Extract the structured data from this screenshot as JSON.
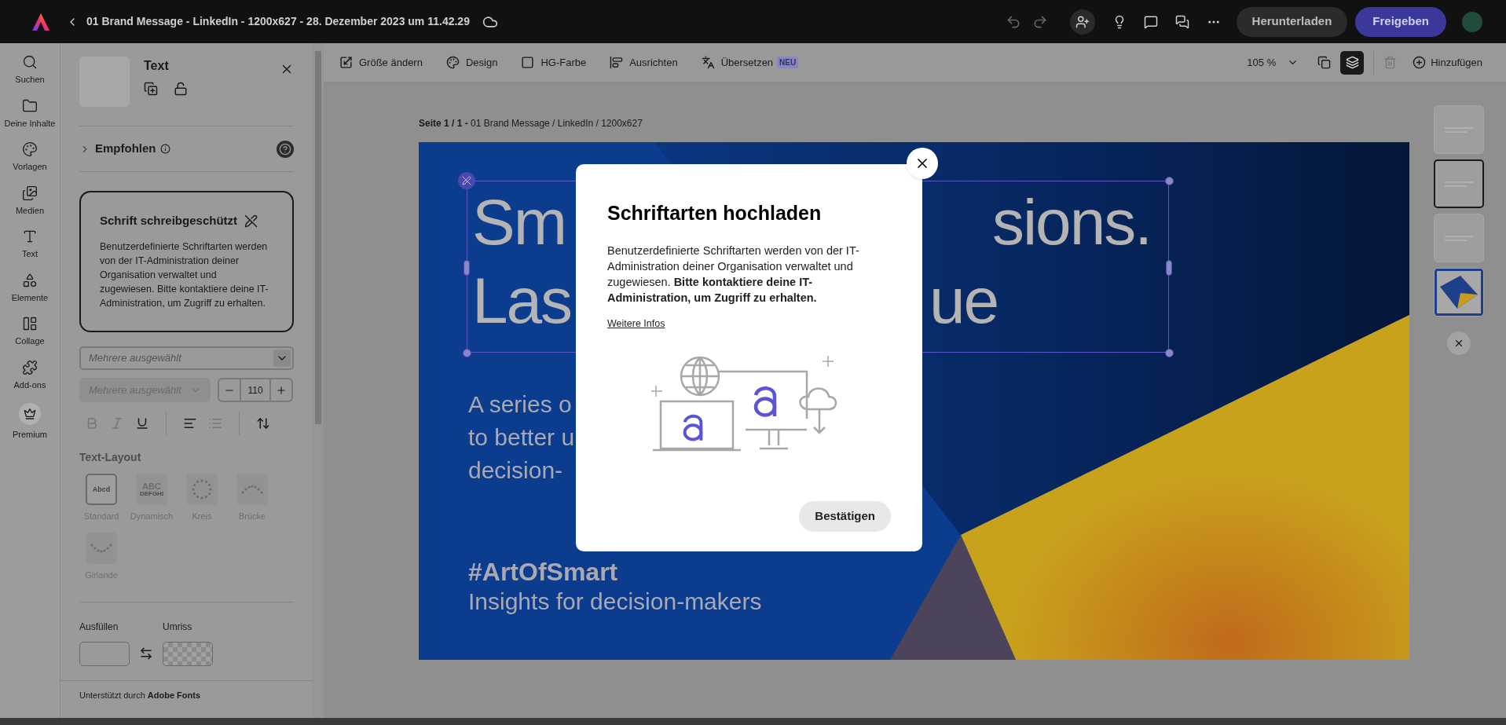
{
  "app_bar": {
    "title": "01 Brand Message - LinkedIn - 1200x627 - 28. Dezember 2023 um 11.42.29",
    "download": "Herunterladen",
    "share": "Freigeben"
  },
  "rail": [
    {
      "label": "Suchen",
      "kind": "search"
    },
    {
      "label": "Deine Inhalte",
      "kind": "folder"
    },
    {
      "label": "Vorlagen",
      "kind": "templates"
    },
    {
      "label": "Medien",
      "kind": "media"
    },
    {
      "label": "Text",
      "kind": "text"
    },
    {
      "label": "Elemente",
      "kind": "shapes"
    },
    {
      "label": "Collage",
      "kind": "collage"
    },
    {
      "label": "Add-ons",
      "kind": "addons"
    },
    {
      "label": "Premium",
      "kind": "premium"
    }
  ],
  "panel": {
    "title": "Text",
    "recommended": "Empfohlen",
    "notice": {
      "title": "Schrift schreibgeschützt",
      "body": "Benutzerdefinierte Schriftarten werden von der IT-Administration deiner Organisation verwaltet und zugewiesen. Bitte kontaktiere deine IT-Administration, um Zugriff zu erhalten."
    },
    "font_family": "Mehrere ausgewählt",
    "font_style": "Mehrere ausgewählt",
    "font_size": "110",
    "format_buttons": [
      {
        "kind": "bold",
        "disabled": true
      },
      {
        "kind": "italic",
        "disabled": true
      },
      {
        "kind": "underline",
        "disabled": false
      },
      {
        "kind": "align-left",
        "disabled": false
      },
      {
        "kind": "list",
        "disabled": true
      },
      {
        "kind": "line-spacing",
        "disabled": false
      }
    ],
    "layout_heading": "Text-Layout",
    "layouts": [
      {
        "label": "Standard",
        "kind": "standard",
        "sample": "Abcd",
        "selected": true
      },
      {
        "label": "Dynamisch",
        "kind": "dynamic",
        "sample": "ABC",
        "sample_2": "DEFGHI",
        "selected": false
      },
      {
        "label": "Kreis",
        "kind": "circle",
        "selected": false
      },
      {
        "label": "Brücke",
        "kind": "bridge",
        "selected": false
      },
      {
        "label": "Girlande",
        "kind": "garland",
        "selected": false
      }
    ],
    "fill_label": "Ausfüllen",
    "stroke_label": "Umriss",
    "footer": "Unterstützt durch **Adobe Fonts**"
  },
  "toolbar": {
    "items": [
      {
        "label": "Größe ändern",
        "kind": "resize"
      },
      {
        "label": "Design",
        "kind": "design"
      },
      {
        "label": "HG-Farbe",
        "kind": "background"
      },
      {
        "label": "Ausrichten",
        "kind": "align"
      },
      {
        "label": "Übersetzen",
        "kind": "translate",
        "badge": "NEU"
      }
    ],
    "zoom": "105 %",
    "add": "Hinzufügen"
  },
  "breadcrumb": "**Seite 1 / 1 -** 01 Brand Message / LinkedIn / 1200x627",
  "canvas": {
    "headline_left": [
      "Sm",
      "Las"
    ],
    "headline_right": [
      "sions.",
      "ue"
    ],
    "subtitle_left": [
      "A series o",
      "to better u",
      "decision-"
    ],
    "hashtag": "#ArtOfSmart",
    "tagline": "Insights for decision-makers"
  },
  "pages": [
    {
      "kind": "text",
      "selected": false
    },
    {
      "kind": "text",
      "selected": true
    },
    {
      "kind": "text",
      "selected": false
    },
    {
      "kind": "image",
      "selected": false
    }
  ],
  "dialog": {
    "title": "Schriftarten hochladen",
    "body": "Benutzerdefinierte Schriftarten werden von der IT-Administration deiner Organisation verwaltet und zugewiesen. **Bitte kontaktiere deine IT-Administration, um Zugriff zu erhalten.**",
    "link": "Weitere Infos",
    "confirm": "Bestätigen"
  }
}
